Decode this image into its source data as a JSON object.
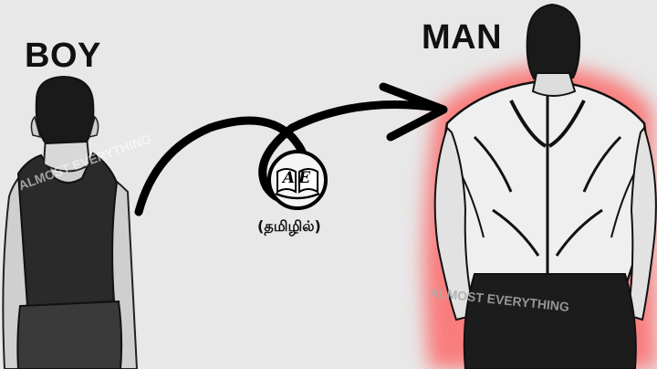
{
  "labels": {
    "boy": "BOY",
    "man": "MAN",
    "language": "(தமிழில்)"
  },
  "logo": {
    "letters": "AE"
  },
  "watermark": {
    "text_left": "ALMOST EVERYTHING",
    "text_right": "ALMOST EVERYTHING"
  },
  "icons": [
    "curved-arrow-icon",
    "book-logo-icon"
  ],
  "colors": {
    "background": "#e8e8e8",
    "glow": "#ff5a5a",
    "ink": "#111111"
  }
}
